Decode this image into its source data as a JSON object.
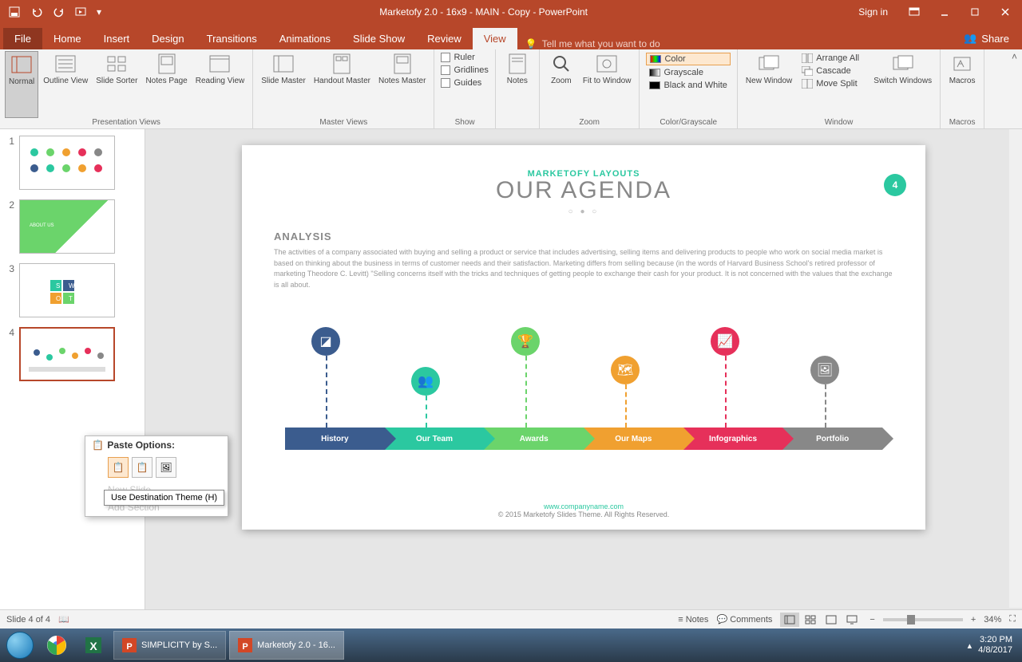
{
  "titlebar": {
    "title": "Marketofy 2.0 - 16x9 - MAIN - Copy - PowerPoint",
    "signin": "Sign in"
  },
  "tabs": {
    "file": "File",
    "home": "Home",
    "insert": "Insert",
    "design": "Design",
    "transitions": "Transitions",
    "animations": "Animations",
    "slideshow": "Slide Show",
    "review": "Review",
    "view": "View",
    "tellme": "Tell me what you want to do",
    "share": "Share"
  },
  "ribbon": {
    "groups": {
      "presentation": "Presentation Views",
      "master": "Master Views",
      "show": "Show",
      "zoom": "Zoom",
      "colorgray": "Color/Grayscale",
      "window": "Window",
      "macros": "Macros"
    },
    "buttons": {
      "normal": "Normal",
      "outline": "Outline View",
      "sorter": "Slide Sorter",
      "notespage": "Notes Page",
      "reading": "Reading View",
      "slidemaster": "Slide Master",
      "handout": "Handout Master",
      "notesmaster": "Notes Master",
      "notes": "Notes",
      "zoom": "Zoom",
      "fit": "Fit to Window",
      "newwin": "New Window",
      "switch": "Switch Windows",
      "macros": "Macros"
    },
    "checks": {
      "ruler": "Ruler",
      "gridlines": "Gridlines",
      "guides": "Guides"
    },
    "colors": {
      "color": "Color",
      "grayscale": "Grayscale",
      "bw": "Black and White"
    },
    "window": {
      "arrange": "Arrange All",
      "cascade": "Cascade",
      "movesplit": "Move Split"
    }
  },
  "thumbs": {
    "n1": "1",
    "n2": "2",
    "n3": "3",
    "n4": "4"
  },
  "context": {
    "paste_header": "Paste Options:",
    "new_slide": "New Slide",
    "add_section": "Add Section",
    "tooltip": "Use Destination Theme (H)"
  },
  "slide": {
    "badge": "4",
    "supertitle": "MARKETOFY LAYOUTS",
    "title": "OUR AGENDA",
    "section": "ANALYSIS",
    "body": "The activities of a company associated with buying and selling a product or service that includes advertising, selling items and delivering products to people who work on social media market is based on thinking about the business in terms of customer needs and their satisfaction. Marketing differs from selling because (in the words of Harvard Business School's retired professor of marketing Theodore C. Levitt) \"Selling concerns itself with the tricks and techniques of getting people to exchange their cash for your product. It is not concerned with the values that the exchange is all about.",
    "timeline": {
      "history": "History",
      "team": "Our Team",
      "awards": "Awards",
      "maps": "Our Maps",
      "infographics": "Infographics",
      "portfolio": "Portfolio"
    },
    "footer_link": "www.companyname.com",
    "footer_text": "© 2015 Marketofy Slides Theme. All Rights Reserved."
  },
  "status": {
    "slide": "Slide 4 of 4",
    "notes": "Notes",
    "comments": "Comments",
    "zoom": "34%"
  },
  "taskbar": {
    "simplicity": "SIMPLICITY by S...",
    "marketofy": "Marketofy 2.0 - 16...",
    "time": "3:20 PM",
    "date": "4/8/2017"
  }
}
